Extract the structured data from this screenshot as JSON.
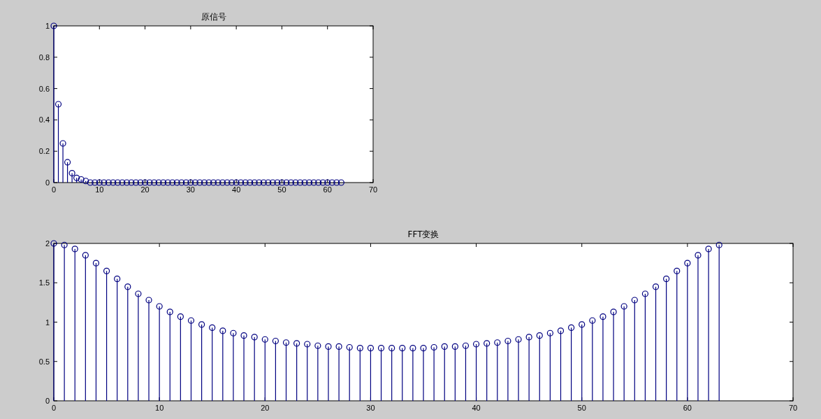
{
  "figure": {
    "axes": [
      {
        "chart_data": {
          "type": "bar",
          "title": "原信号",
          "x": [
            0,
            1,
            2,
            3,
            4,
            5,
            6,
            7,
            8,
            9,
            10,
            11,
            12,
            13,
            14,
            15,
            16,
            17,
            18,
            19,
            20,
            21,
            22,
            23,
            24,
            25,
            26,
            27,
            28,
            29,
            30,
            31,
            32,
            33,
            34,
            35,
            36,
            37,
            38,
            39,
            40,
            41,
            42,
            43,
            44,
            45,
            46,
            47,
            48,
            49,
            50,
            51,
            52,
            53,
            54,
            55,
            56,
            57,
            58,
            59,
            60,
            61,
            62,
            63
          ],
          "series": [
            {
              "color": "#000080",
              "values": [
                1,
                0.5,
                0.25,
                0.13,
                0.06,
                0.03,
                0.02,
                0.01,
                0,
                0,
                0,
                0,
                0,
                0,
                0,
                0,
                0,
                0,
                0,
                0,
                0,
                0,
                0,
                0,
                0,
                0,
                0,
                0,
                0,
                0,
                0,
                0,
                0,
                0,
                0,
                0,
                0,
                0,
                0,
                0,
                0,
                0,
                0,
                0,
                0,
                0,
                0,
                0,
                0,
                0,
                0,
                0,
                0,
                0,
                0,
                0,
                0,
                0,
                0,
                0,
                0,
                0,
                0,
                0
              ]
            }
          ],
          "xlim": [
            0,
            70
          ],
          "ylim": [
            0,
            1
          ],
          "xticks": [
            0,
            10,
            20,
            30,
            40,
            50,
            60,
            70
          ],
          "yticks": [
            0,
            0.2,
            0.4,
            0.6,
            0.8,
            1
          ]
        }
      },
      {
        "chart_data": {
          "type": "bar",
          "title": "FFT变换",
          "x": [
            0,
            1,
            2,
            3,
            4,
            5,
            6,
            7,
            8,
            9,
            10,
            11,
            12,
            13,
            14,
            15,
            16,
            17,
            18,
            19,
            20,
            21,
            22,
            23,
            24,
            25,
            26,
            27,
            28,
            29,
            30,
            31,
            32,
            33,
            34,
            35,
            36,
            37,
            38,
            39,
            40,
            41,
            42,
            43,
            44,
            45,
            46,
            47,
            48,
            49,
            50,
            51,
            52,
            53,
            54,
            55,
            56,
            57,
            58,
            59,
            60,
            61,
            62,
            63
          ],
          "series": [
            {
              "color": "#000080",
              "values": [
                2,
                1.98,
                1.93,
                1.85,
                1.75,
                1.65,
                1.55,
                1.45,
                1.36,
                1.28,
                1.2,
                1.13,
                1.07,
                1.02,
                0.97,
                0.93,
                0.89,
                0.86,
                0.83,
                0.81,
                0.78,
                0.76,
                0.74,
                0.73,
                0.72,
                0.7,
                0.69,
                0.69,
                0.68,
                0.67,
                0.67,
                0.67,
                0.67,
                0.67,
                0.67,
                0.67,
                0.68,
                0.69,
                0.69,
                0.7,
                0.72,
                0.73,
                0.74,
                0.76,
                0.78,
                0.81,
                0.83,
                0.86,
                0.89,
                0.93,
                0.97,
                1.02,
                1.07,
                1.13,
                1.2,
                1.28,
                1.36,
                1.45,
                1.55,
                1.65,
                1.75,
                1.85,
                1.93,
                1.98
              ]
            }
          ],
          "xlim": [
            0,
            70
          ],
          "ylim": [
            0,
            2
          ],
          "xticks": [
            0,
            10,
            20,
            30,
            40,
            50,
            60,
            70
          ],
          "yticks": [
            0,
            0.5,
            1,
            1.5,
            2
          ]
        }
      }
    ]
  }
}
